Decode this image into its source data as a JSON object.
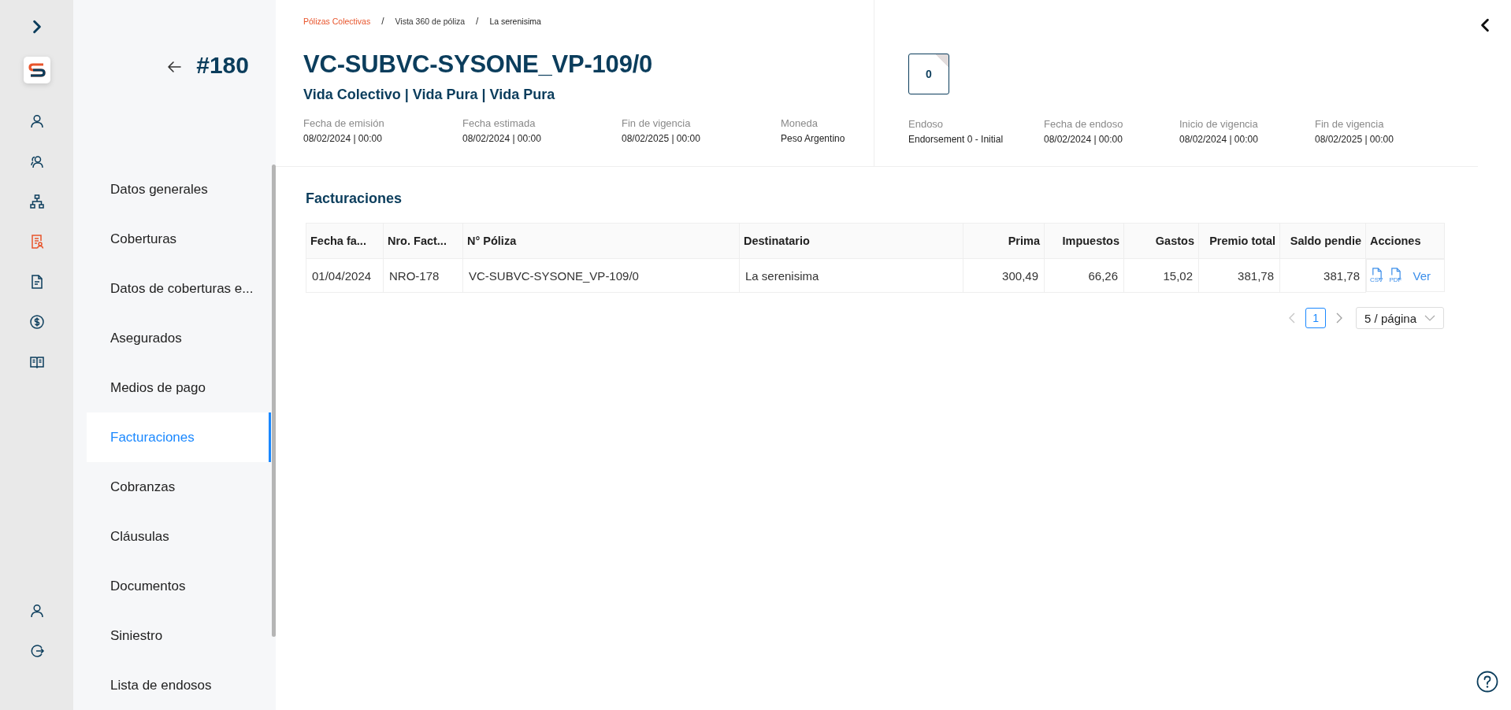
{
  "rail": {
    "items": [
      {
        "kind": "user",
        "selected": false
      },
      {
        "kind": "users",
        "selected": false
      },
      {
        "kind": "hierarchy",
        "selected": false
      },
      {
        "kind": "policy",
        "selected": true
      },
      {
        "kind": "document",
        "selected": false
      },
      {
        "kind": "money",
        "selected": false
      },
      {
        "kind": "book",
        "selected": false
      }
    ],
    "bottom_items": [
      {
        "kind": "user",
        "selected": false
      },
      {
        "kind": "logout",
        "selected": false
      }
    ]
  },
  "record_number": "#180",
  "side_menu": {
    "items": [
      {
        "label": "Datos generales",
        "selected": false
      },
      {
        "label": "Coberturas",
        "selected": false
      },
      {
        "label": "Datos de coberturas e...",
        "selected": false
      },
      {
        "label": "Asegurados",
        "selected": false
      },
      {
        "label": "Medios de pago",
        "selected": false
      },
      {
        "label": "Facturaciones",
        "selected": true
      },
      {
        "label": "Cobranzas",
        "selected": false
      },
      {
        "label": "Cláusulas",
        "selected": false
      },
      {
        "label": "Documentos",
        "selected": false
      },
      {
        "label": "Siniestro",
        "selected": false
      },
      {
        "label": "Lista de endosos",
        "selected": false
      }
    ]
  },
  "breadcrumb": [
    {
      "label": "Pólizas Colectivas",
      "selected": false
    },
    {
      "label": "Vista 360 de póliza",
      "selected": false
    },
    {
      "label": "La serenisima",
      "selected": true
    }
  ],
  "breadcrumb_separator": "/",
  "policy": {
    "title": "VC-SUBVC-SYSONE_VP-109/0",
    "subtitle": "Vida Colectivo | Vida Pura | Vida Pura",
    "fields": [
      {
        "label": "Fecha de emisión",
        "value": "08/02/2024 | 00:00"
      },
      {
        "label": "Fecha estimada",
        "value": "08/02/2024 | 00:00"
      },
      {
        "label": "Fin de vigencia",
        "value": "08/02/2025 | 00:00"
      },
      {
        "label": "Moneda",
        "value": "Peso Argentino"
      }
    ]
  },
  "endorsement": {
    "badge": "0",
    "fields": [
      {
        "label": "Endoso",
        "value": "Endorsement 0 - Initial"
      },
      {
        "label": "Fecha de endoso",
        "value": "08/02/2024 | 00:00"
      },
      {
        "label": "Inicio de vigencia",
        "value": "08/02/2024 | 00:00"
      },
      {
        "label": "Fin de vigencia",
        "value": "08/02/2025 | 00:00"
      }
    ]
  },
  "section_title": "Facturaciones",
  "table": {
    "columns": [
      {
        "label": "Fecha fa...",
        "kind": "text"
      },
      {
        "label": "Nro. Fact...",
        "kind": "text"
      },
      {
        "label": "N° Póliza",
        "kind": "text"
      },
      {
        "label": "Destinatario",
        "kind": "text"
      },
      {
        "label": "Prima",
        "kind": "amount"
      },
      {
        "label": "Impuestos",
        "kind": "amount"
      },
      {
        "label": "Gastos",
        "kind": "amount"
      },
      {
        "label": "Premio total",
        "kind": "amount"
      },
      {
        "label": "Saldo pendie",
        "kind": "amount"
      },
      {
        "label": "Acciones",
        "kind": "actions"
      }
    ],
    "rows": [
      {
        "cells": [
          "01/04/2024",
          "NRO-178",
          "VC-SUBVC-SYSONE_VP-109/0",
          "La serenisima",
          "300,49",
          "66,26",
          "15,02",
          "381,78",
          "381,78"
        ],
        "actions": {
          "csv": "CSV",
          "pdf": "PDF",
          "link": "Ver"
        }
      }
    ]
  },
  "pagination": {
    "pages": [
      {
        "label": "1",
        "selected": true
      }
    ],
    "page_size": "5 / página"
  }
}
